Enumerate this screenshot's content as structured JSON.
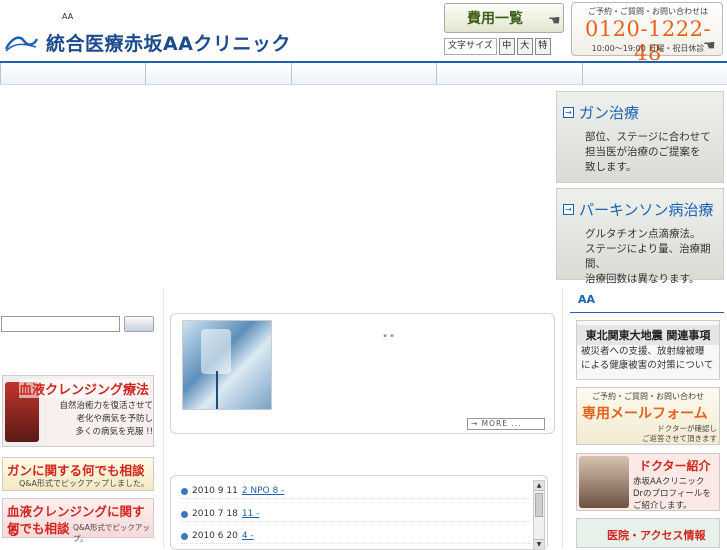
{
  "header": {
    "tagline": "AA",
    "logo_text": "統合医療赤坂AAクリニック",
    "fee_button": "費用一覧",
    "font_size_label": "文字サイズ",
    "font_size_options": [
      "中",
      "大",
      "特"
    ],
    "contact": {
      "label": "ご予約・ご質問・お問い合わせは",
      "phone": "0120-1222-48",
      "hours": "10:00〜19:00 日曜・祝日休診"
    }
  },
  "nav": {
    "items": [
      "",
      "",
      "",
      "",
      ""
    ]
  },
  "hero": {
    "panels": [
      {
        "title": "ガン治療",
        "lines": [
          "部位、ステージに合わせて",
          "担当医が治療のご提案を",
          "致します。"
        ]
      },
      {
        "title": "パーキンソン病治療",
        "lines": [
          "グルタチオン点滴療法。",
          "ステージにより量、治療期間、",
          "治療回数は異なります。"
        ]
      }
    ]
  },
  "left": {
    "search_placeholder": "",
    "search_button": "",
    "banner_cleansing": {
      "title": "血液クレンジング療法",
      "lines": [
        "自然治癒力を復活させて",
        "老化や病気を予防し",
        "多くの病気を克服 !!"
      ]
    },
    "banner_cancer_qa": {
      "title": "ガンに関する何でも相談",
      "sub": "Q&A形式でピックアップしました。"
    },
    "banner_blood_qa": {
      "title1": "血液クレンジングに関する",
      "title2": "何でも相談",
      "sub": "Q&A形式でピックアップ。"
    }
  },
  "center": {
    "feature_quote": "\" \"",
    "more_label": "→ MORE ...",
    "news": [
      {
        "date": "2010 9 11",
        "link": "2 NPO 8 -"
      },
      {
        "date": "2010 7 18",
        "link": "11 -"
      },
      {
        "date": "2010 6 20",
        "link": "4 -"
      }
    ]
  },
  "right": {
    "title": "AA",
    "quake": {
      "title": "東北関東大地震 関連事項",
      "lines": [
        "被災者への支援、放射線被曝",
        "による健康被害の対策について"
      ]
    },
    "mail": {
      "top": "ご予約・ご質問・お問い合わせ",
      "title": "専用メールフォーム",
      "note_lines": [
        "ドクターが確認し",
        "ご返答させて頂きます"
      ]
    },
    "doctor": {
      "title": "ドクター紹介",
      "lines": [
        "赤坂AAクリニック",
        "Drのプロフィールを",
        "ご紹介します。"
      ]
    },
    "access": {
      "title": "医院・アクセス情報"
    }
  },
  "colors": {
    "brand_blue": "#1b62b6",
    "accent_orange": "#e6621a",
    "accent_red": "#d0261f"
  }
}
